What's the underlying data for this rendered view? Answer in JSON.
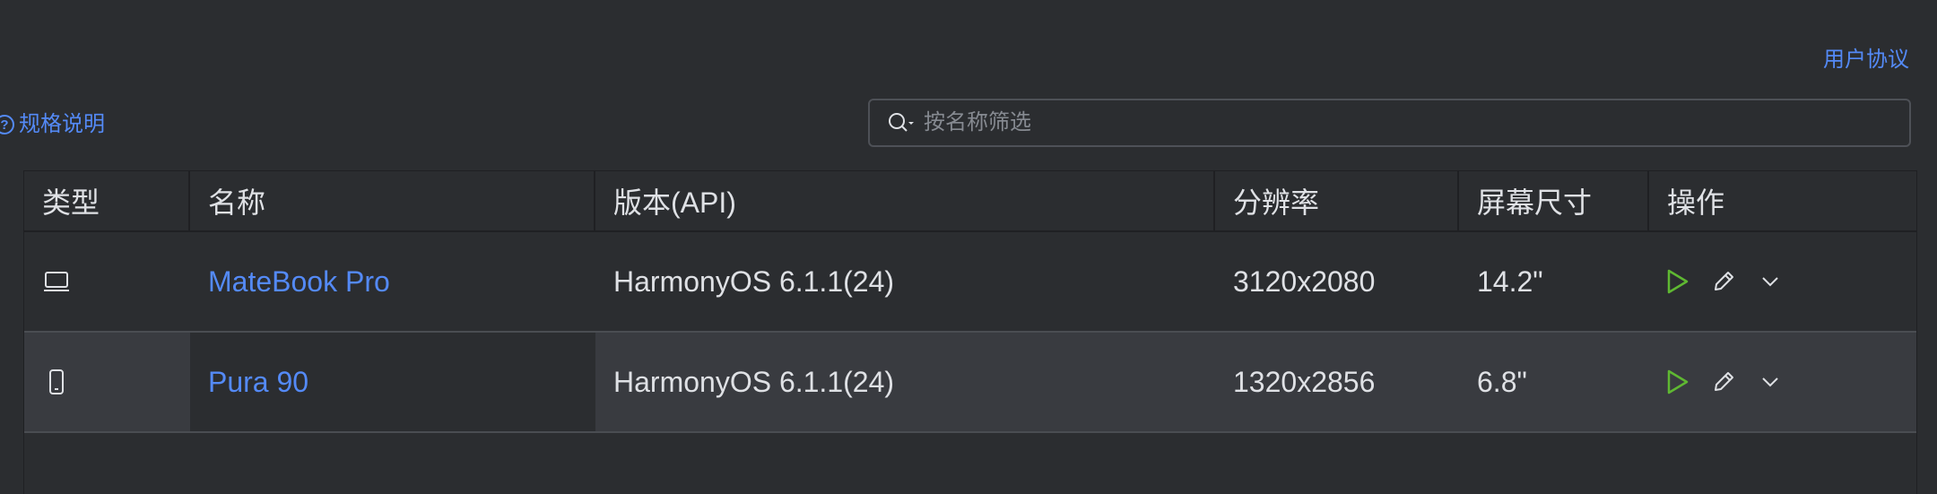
{
  "links": {
    "agreement": "用户协议",
    "spec": "规格说明"
  },
  "search": {
    "placeholder": "按名称筛选"
  },
  "table": {
    "headers": [
      "类型",
      "名称",
      "版本(API)",
      "分辨率",
      "屏幕尺寸",
      "操作"
    ],
    "rows": [
      {
        "type_icon": "laptop-icon",
        "name": "MateBook Pro",
        "version": "HarmonyOS 6.1.1(24)",
        "resolution": "3120x2080",
        "size": "14.2\""
      },
      {
        "type_icon": "phone-icon",
        "name": "Pura 90",
        "version": "HarmonyOS 6.1.1(24)",
        "resolution": "1320x2856",
        "size": "6.8\""
      }
    ]
  },
  "colors": {
    "background": "#2b2d30",
    "link": "#548af7",
    "run_icon": "#5fb832",
    "selected_row": "#393b40"
  }
}
